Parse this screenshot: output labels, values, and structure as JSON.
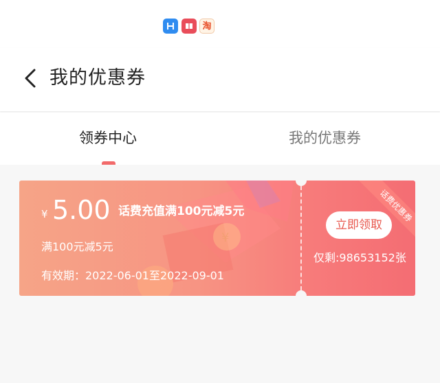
{
  "statusbar": {
    "icons": [
      "app-blue-icon",
      "book-icon",
      "taobao-icon"
    ],
    "taobao_glyph": "淘"
  },
  "header": {
    "title": "我的优惠券",
    "back_icon": "chevron-left-icon"
  },
  "tabs": [
    {
      "label": "领券中心",
      "active": true
    },
    {
      "label": "我的优惠券",
      "active": false
    }
  ],
  "coupon": {
    "currency_symbol": "¥",
    "amount": "5.00",
    "name": "话费充值满100元减5元",
    "condition": "满100元减5元",
    "validity": "有效期：2022-06-01至2022-09-01",
    "claim_label": "立即领取",
    "remaining": "仅剩:98653152张",
    "ribbon_label": "话费优惠券"
  },
  "colors": {
    "accent": "#f26a6a",
    "coupon_start": "#f6a487",
    "coupon_end": "#f46d73",
    "claim_text": "#e8574d"
  }
}
